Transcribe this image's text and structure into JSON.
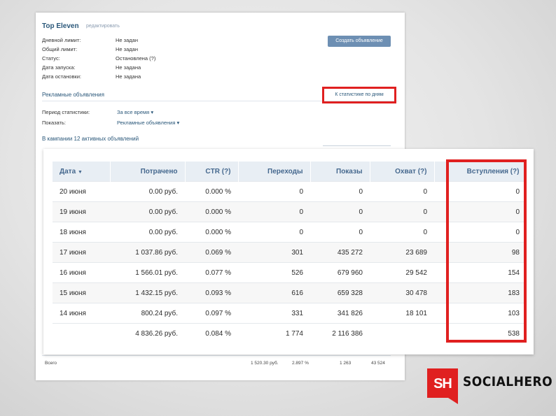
{
  "campaign": {
    "title": "Top Eleven",
    "edit_link": "редактировать",
    "info": [
      {
        "label": "Дневной лимит:",
        "value": "Не задан"
      },
      {
        "label": "Общий лимит:",
        "value": "Не задан"
      },
      {
        "label": "Статус:",
        "value": "Остановлена (?)"
      },
      {
        "label": "Дата запуска:",
        "value": "Не задана"
      },
      {
        "label": "Дата остановки:",
        "value": "Не задана"
      }
    ],
    "stop_button": "Создать объявление",
    "ads_section_title": "Рекламные объявления",
    "daily_stats_link": "К статистике по дням",
    "filters": [
      {
        "label": "Период статистики:",
        "value": "За все время"
      },
      {
        "label": "Показать:",
        "value": "Рекламные объявления"
      }
    ],
    "campaign_subtitle": "В кампании 12 активных объявлений",
    "totals_strip": {
      "label": "Всего",
      "spent": "1 520.30 руб.",
      "ctr": "2.897 %",
      "clicks": "1 263",
      "views": "43 524"
    }
  },
  "stats": {
    "columns": [
      "Дата",
      "Потрачено",
      "CTR (?)",
      "Переходы",
      "Показы",
      "Охват (?)",
      "Вступления (?)"
    ],
    "sort_indicator": "▼",
    "rows": [
      [
        "20 июня",
        "0.00 руб.",
        "0.000 %",
        "0",
        "0",
        "0",
        "0"
      ],
      [
        "19 июня",
        "0.00 руб.",
        "0.000 %",
        "0",
        "0",
        "0",
        "0"
      ],
      [
        "18 июня",
        "0.00 руб.",
        "0.000 %",
        "0",
        "0",
        "0",
        "0"
      ],
      [
        "17 июня",
        "1 037.86 руб.",
        "0.069 %",
        "301",
        "435 272",
        "23 689",
        "98"
      ],
      [
        "16 июня",
        "1 566.01 руб.",
        "0.077 %",
        "526",
        "679 960",
        "29 542",
        "154"
      ],
      [
        "15 июня",
        "1 432.15 руб.",
        "0.093 %",
        "616",
        "659 328",
        "30 478",
        "183"
      ],
      [
        "14 июня",
        "800.24 руб.",
        "0.097 %",
        "331",
        "341 826",
        "18 101",
        "103"
      ]
    ],
    "total": [
      "",
      "4 836.26 руб.",
      "0.084 %",
      "1 774",
      "2 116 386",
      "",
      "538"
    ]
  },
  "logo": {
    "mark": "SH",
    "name": "SOCIALHERO",
    "color": "#e02020"
  }
}
